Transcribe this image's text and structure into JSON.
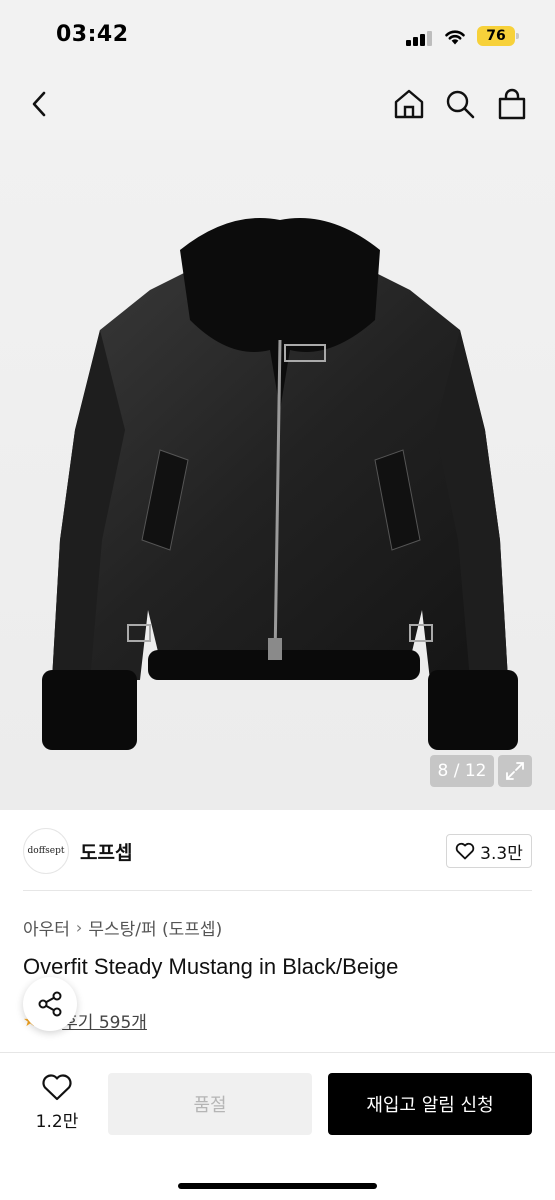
{
  "status_bar": {
    "time": "03:42",
    "battery": "76"
  },
  "nav": {
    "back_icon": "chevron-left-icon",
    "home_icon": "home-icon",
    "search_icon": "search-icon",
    "bag_icon": "shopping-bag-icon"
  },
  "gallery": {
    "counter": "8 / 12",
    "expand_icon": "expand-icon"
  },
  "store": {
    "logo_text": "doffsept",
    "name": "도프셉",
    "likes": "3.3만"
  },
  "breadcrumb": {
    "category": "아우터",
    "subcategory": "무스탕/퍼 (도프셉)"
  },
  "product": {
    "title": "Overfit Steady Mustang in Black/Beige",
    "rating": "5",
    "reviews": "후기 595개"
  },
  "bottom": {
    "wish_count": "1.2만",
    "soldout_label": "품절",
    "restock_label": "재입고 알림 신청"
  },
  "colors": {
    "primary": "#000000",
    "disabled_bg": "#f0f0f0",
    "disabled_text": "#b5b5b5",
    "battery": "#f7d13a"
  }
}
